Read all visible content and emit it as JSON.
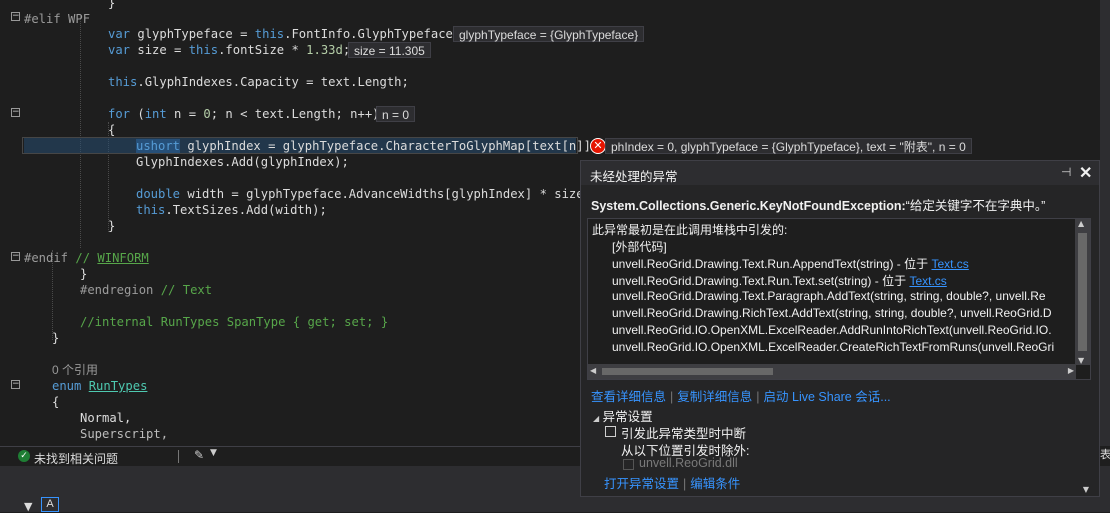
{
  "code": {
    "lines": [
      {
        "id": "l0",
        "text": "}"
      },
      {
        "id": "l1",
        "text": "#elif WPF"
      },
      {
        "id": "l2",
        "text": "var glyphTypeface = this.FontInfo.GlyphTypeface;"
      },
      {
        "id": "l3",
        "text": "var size = this.fontSize * 1.33d;"
      },
      {
        "id": "l4",
        "text": "this.GlyphIndexes.Capacity = text.Length;"
      },
      {
        "id": "l5",
        "text": "for (int n = 0; n < text.Length; n++)"
      },
      {
        "id": "l6",
        "text": "{"
      },
      {
        "id": "l7",
        "text": "ushort glyphIndex = glyphTypeface.CharacterToGlyphMap[text[n]];"
      },
      {
        "id": "l8",
        "text": "GlyphIndexes.Add(glyphIndex);"
      },
      {
        "id": "l9",
        "text": "double width = glyphTypeface.AdvanceWidths[glyphIndex] * size;"
      },
      {
        "id": "l10",
        "text": "this.TextSizes.Add(width);"
      },
      {
        "id": "l11",
        "text": "}"
      },
      {
        "id": "l12",
        "text": "#endif // WINFORM"
      },
      {
        "id": "l13",
        "text": "}"
      },
      {
        "id": "l14",
        "text": "#endregion // Text"
      },
      {
        "id": "l15",
        "text": "//internal RunTypes SpanType { get; set; }"
      },
      {
        "id": "l16",
        "text": "}"
      },
      {
        "id": "l17",
        "text": "0 个引用"
      },
      {
        "id": "l18",
        "text": "enum RunTypes"
      },
      {
        "id": "l19",
        "text": "{"
      },
      {
        "id": "l20",
        "text": "Normal,"
      },
      {
        "id": "l21",
        "text": "Superscript,"
      }
    ],
    "datatips": {
      "glyphTypeface": "glyphTypeface = {GlyphTypeface}",
      "size": "size = 11.305",
      "n": "n = 0",
      "inline": "phIndex = 0,  glyphTypeface = {GlyphTypeface},  text = \"附表\",  n = 0"
    }
  },
  "status": {
    "issues": "未找到相关问题"
  },
  "exception_popup": {
    "title": "未经处理的异常",
    "exception_type": "System.Collections.Generic.KeyNotFoundException:",
    "exception_message": "“给定关键字不在字典中。”",
    "stack_header": "此异常最初是在此调用堆栈中引发的:",
    "stack": [
      {
        "text": "[外部代码]",
        "link": ""
      },
      {
        "text": "unvell.ReoGrid.Drawing.Text.Run.AppendText(string) - 位于 ",
        "link": "Text.cs"
      },
      {
        "text": "unvell.ReoGrid.Drawing.Text.Run.Text.set(string) - 位于 ",
        "link": "Text.cs"
      },
      {
        "text": "unvell.ReoGrid.Drawing.Text.Paragraph.AddText(string, string, double?, unvell.Re",
        "link": ""
      },
      {
        "text": "unvell.ReoGrid.Drawing.RichText.AddText(string, string, double?, unvell.ReoGrid.D",
        "link": ""
      },
      {
        "text": "unvell.ReoGrid.IO.OpenXML.ExcelReader.AddRunIntoRichText(unvell.ReoGrid.IO.",
        "link": ""
      },
      {
        "text": "unvell.ReoGrid.IO.OpenXML.ExcelReader.CreateRichTextFromRuns(unvell.ReoGri",
        "link": ""
      }
    ],
    "links": [
      "查看详细信息",
      "复制详细信息",
      "启动 Live Share 会话..."
    ],
    "settings_header": "异常设置",
    "break_option": "引发此异常类型时中断",
    "except_label": "从以下位置引发时除外:",
    "except_item": "unvell.ReoGrid.dll",
    "bottom_links": [
      "打开异常设置",
      "编辑条件"
    ]
  },
  "right_stub_text": "表"
}
